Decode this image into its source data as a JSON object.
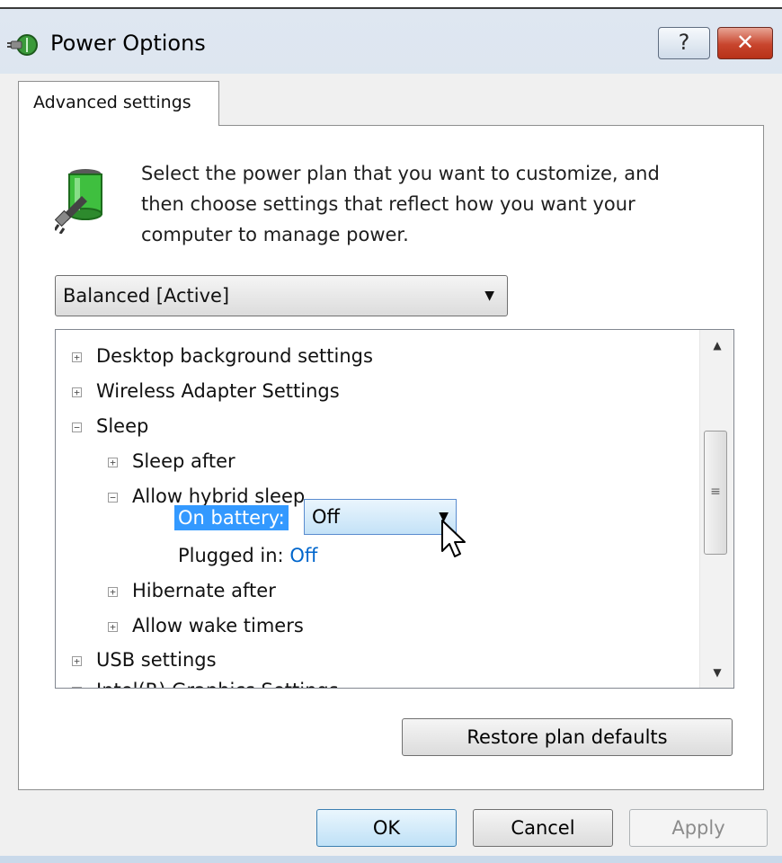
{
  "window": {
    "title": "Power Options",
    "help_label": "?",
    "close_label": "✕"
  },
  "tab": {
    "label": "Advanced settings"
  },
  "intro": {
    "line1": "Select the power plan that you want to customize, and",
    "line2": "then choose settings that reflect how you want your",
    "line3": "computer to manage power."
  },
  "plan_select": {
    "value": "Balanced [Active]",
    "arrow": "▼"
  },
  "tree": {
    "items": {
      "desktop_bg": {
        "label": "Desktop background settings",
        "toggle": "+"
      },
      "wireless": {
        "label": "Wireless Adapter Settings",
        "toggle": "+"
      },
      "sleep": {
        "label": "Sleep",
        "toggle": "−"
      },
      "sleep_after": {
        "label": "Sleep after",
        "toggle": "+"
      },
      "hybrid": {
        "label": "Allow hybrid sleep",
        "toggle": "−"
      },
      "on_battery": {
        "label": "On battery:",
        "value": "Off"
      },
      "plugged_in": {
        "label": "Plugged in:",
        "value": "Off"
      },
      "hibernate": {
        "label": "Hibernate after",
        "toggle": "+"
      },
      "wake_timers": {
        "label": "Allow wake timers",
        "toggle": "+"
      },
      "usb": {
        "label": "USB settings",
        "toggle": "+"
      },
      "intel": {
        "label": "Intel(R) Graphics Settings",
        "toggle": "+"
      }
    },
    "scroll_up": "▲",
    "scroll_down": "▼",
    "thumb_grip": "≡",
    "combo_arrow": "▼"
  },
  "buttons": {
    "restore": "Restore plan defaults",
    "ok": "OK",
    "cancel": "Cancel",
    "apply": "Apply"
  },
  "icons": {
    "title": "power-plug-icon",
    "intro": "battery-plug-icon",
    "cursor": "mouse-pointer-icon"
  },
  "colors": {
    "selection": "#3399ff",
    "value_link": "#0066cc",
    "close_button": "#c8452d"
  }
}
